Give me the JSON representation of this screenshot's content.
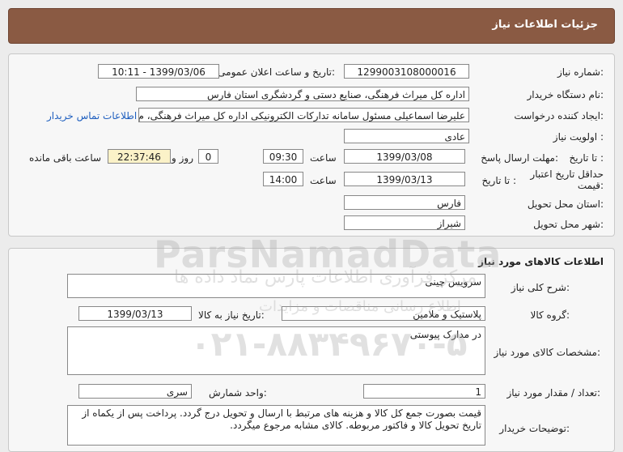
{
  "header": {
    "title": "جزئیات اطلاعات نیاز"
  },
  "info": {
    "need_number_label": "شماره نیاز:",
    "need_number": "1299003108000016",
    "announce_label": "تاریخ و ساعت اعلان عمومی:",
    "announce_value": "1399/03/06 - 10:11",
    "buyer_org_label": "نام دستگاه خریدار:",
    "buyer_org": "اداره کل میراث فرهنگی، صنایع دستی و گردشگری استان فارس",
    "creator_label": "ایجاد کننده درخواست:",
    "creator": "علیرضا اسماعیلی مسئول سامانه تدارکات الکترونیکی اداره کل میراث فرهنگی، م",
    "contact_link": "اطلاعات تماس خریدار",
    "priority_label": "اولویت نیاز :",
    "priority": "عادی",
    "deadline_label": "مهلت ارسال پاسخ:",
    "to_date_label": "تا تاریخ :",
    "deadline_date": "1399/03/08",
    "time_label": "ساعت",
    "deadline_time": "09:30",
    "days_value": "0",
    "days_label": "روز و",
    "remaining_time": "22:37:46",
    "remaining_label": "ساعت باقی مانده",
    "validity_label": "حداقل تاریخ اعتبار قیمت:",
    "validity_date": "1399/03/13",
    "validity_time": "14:00",
    "province_label": "استان محل تحویل:",
    "province": "فارس",
    "city_label": "شهر محل تحویل:",
    "city": "شیراز"
  },
  "goods": {
    "section_title": "اطلاعات کالاهای مورد نیاز",
    "desc_label": "شرح کلی نیاز:",
    "desc": "سرویس چینی",
    "group_label": "گروه کالا:",
    "group": "پلاستیک و ملامین",
    "need_date_label": "تاریخ نیاز به کالا:",
    "need_date": "1399/03/13",
    "spec_label": "مشخصات کالای مورد نیاز:",
    "spec": "در مدارک پیوستی",
    "count_label": "تعداد / مقدار مورد نیاز:",
    "count": "1",
    "unit_label": "واحد شمارش:",
    "unit": "سری",
    "buyer_notes_label": "توضیحات خریدار:",
    "buyer_notes": "قیمت بصورت جمع کل کالا و هزینه های مرتبط با ارسال و تحویل درج گردد. پرداخت پس از یکماه از تاریخ تحویل کالا و فاکتور مربوطه. کالای مشابه مرجوع میگردد."
  },
  "watermark": {
    "brand": "ParsNamadData",
    "line1": "مرکز فرآوری اطلاعات پارس نماد داده ها",
    "line2": "اطلاع رسانی مناقصات و مزایدات",
    "phone": "۰۲۱-۸۸۳۴۹۶۷۰-۵"
  },
  "colors": {
    "header_bg": "#8a5a43",
    "highlight_bg": "#fbf2c8",
    "link": "#1f5fbf"
  }
}
